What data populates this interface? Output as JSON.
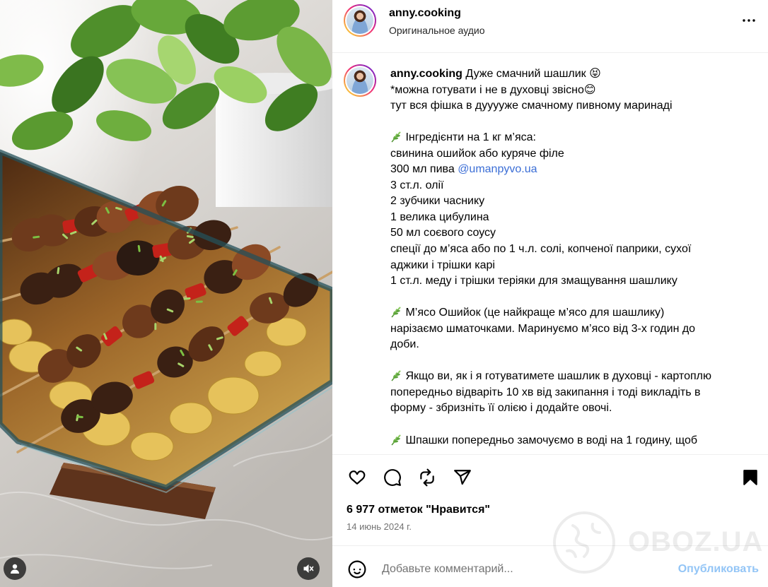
{
  "post": {
    "author": {
      "username": "anny.cooking",
      "audio": "Оригинальное аудио"
    }
  },
  "caption": {
    "lines": [
      {
        "segments": [
          {
            "type": "username",
            "text": "anny.cooking"
          },
          {
            "type": "text",
            "text": " Дуже смачний шашлик 😝"
          }
        ]
      },
      {
        "segments": [
          {
            "type": "text",
            "text": "*можна готувати і не в духовці звісно😊"
          }
        ]
      },
      {
        "segments": [
          {
            "type": "text",
            "text": "тут вся фішка в дууууже смачному пивному маринаді"
          }
        ]
      },
      {
        "segments": []
      },
      {
        "icon": "herb-icon",
        "segments": [
          {
            "type": "text",
            "text": " Інгредієнти на 1 кг м’яса:"
          }
        ]
      },
      {
        "segments": [
          {
            "type": "text",
            "text": "свинина ошийок або куряче філе"
          }
        ]
      },
      {
        "segments": [
          {
            "type": "text",
            "text": "300 мл пива "
          },
          {
            "type": "mention",
            "text": "@umanpyvo.ua"
          }
        ]
      },
      {
        "segments": [
          {
            "type": "text",
            "text": "3 ст.л. олії"
          }
        ]
      },
      {
        "segments": [
          {
            "type": "text",
            "text": "2 зубчики часнику"
          }
        ]
      },
      {
        "segments": [
          {
            "type": "text",
            "text": "1 велика цибулина"
          }
        ]
      },
      {
        "segments": [
          {
            "type": "text",
            "text": "50 мл соєвого соусу"
          }
        ]
      },
      {
        "segments": [
          {
            "type": "text",
            "text": "спеції до м’яса або по 1 ч.л. солі, копченої паприки, сухої"
          }
        ]
      },
      {
        "segments": [
          {
            "type": "text",
            "text": "аджики і трішки карі"
          }
        ]
      },
      {
        "segments": [
          {
            "type": "text",
            "text": "1 ст.л. меду і трішки теріяки для змащування шашлику"
          }
        ]
      },
      {
        "segments": []
      },
      {
        "icon": "herb-icon",
        "segments": [
          {
            "type": "text",
            "text": " М’ясо Ошийок (це найкраще м’ясо для шашлику)"
          }
        ]
      },
      {
        "segments": [
          {
            "type": "text",
            "text": "нарізаємо шматочками. Маринуємо м’ясо від 3-х годин до"
          }
        ]
      },
      {
        "segments": [
          {
            "type": "text",
            "text": "доби."
          }
        ]
      },
      {
        "segments": []
      },
      {
        "icon": "herb-icon",
        "segments": [
          {
            "type": "text",
            "text": " Якщо ви, як і я готуватимете шашлик в духовці - картоплю"
          }
        ]
      },
      {
        "segments": [
          {
            "type": "text",
            "text": "попередньо відваріть 10 хв від закипання і тоді викладіть в"
          }
        ]
      },
      {
        "segments": [
          {
            "type": "text",
            "text": "форму - збризніть її олією і додайте овочі."
          }
        ]
      },
      {
        "segments": []
      },
      {
        "icon": "herb-icon",
        "segments": [
          {
            "type": "text",
            "text": " Шпашки попередньо замочуємо в воді на 1 годину, щоб"
          }
        ]
      }
    ]
  },
  "stats": {
    "likes": "6 977 отметок \"Нравится\"",
    "date": "14 июнь 2024 г."
  },
  "comment_box": {
    "placeholder": "Добавьте комментарий...",
    "submit_label": "Опубликовать"
  },
  "watermark": "OBOZ.UA",
  "icons": {
    "more": "more-horizontal-icon",
    "like": "heart-icon",
    "comment": "comment-icon",
    "repost": "repost-icon",
    "share": "send-icon",
    "save": "bookmark-icon",
    "emoji": "smiley-icon",
    "tag_people": "user-tag-icon",
    "mute": "muted-speaker-icon",
    "caption_bullet": "herb-icon"
  },
  "colors": {
    "text": "#000000",
    "secondary_text": "#737373",
    "mention_link": "#3b6ed6",
    "post_button": "#93c5f6",
    "divider": "#efefef",
    "avatar_ring": [
      "#f9ce34",
      "#ee2a7b",
      "#6228d7"
    ]
  }
}
